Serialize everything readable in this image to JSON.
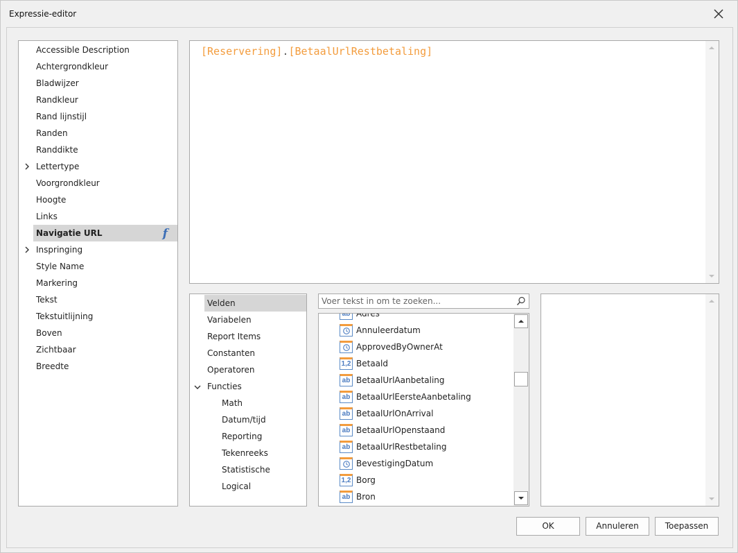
{
  "window": {
    "title": "Expressie-editor"
  },
  "properties": [
    {
      "label": "Accessible Description",
      "expandable": false,
      "selected": false
    },
    {
      "label": "Achtergrondkleur",
      "expandable": false,
      "selected": false
    },
    {
      "label": "Bladwijzer",
      "expandable": false,
      "selected": false
    },
    {
      "label": "Randkleur",
      "expandable": false,
      "selected": false
    },
    {
      "label": "Rand lijnstijl",
      "expandable": false,
      "selected": false
    },
    {
      "label": "Randen",
      "expandable": false,
      "selected": false
    },
    {
      "label": "Randdikte",
      "expandable": false,
      "selected": false
    },
    {
      "label": "Lettertype",
      "expandable": true,
      "selected": false
    },
    {
      "label": "Voorgrondkleur",
      "expandable": false,
      "selected": false
    },
    {
      "label": "Hoogte",
      "expandable": false,
      "selected": false
    },
    {
      "label": "Links",
      "expandable": false,
      "selected": false
    },
    {
      "label": "Navigatie URL",
      "expandable": false,
      "selected": true
    },
    {
      "label": "Inspringing",
      "expandable": true,
      "selected": false
    },
    {
      "label": "Style Name",
      "expandable": false,
      "selected": false
    },
    {
      "label": "Markering",
      "expandable": false,
      "selected": false
    },
    {
      "label": "Tekst",
      "expandable": false,
      "selected": false
    },
    {
      "label": "Tekstuitlijning",
      "expandable": false,
      "selected": false
    },
    {
      "label": "Boven",
      "expandable": false,
      "selected": false
    },
    {
      "label": "Zichtbaar",
      "expandable": false,
      "selected": false
    },
    {
      "label": "Breedte",
      "expandable": false,
      "selected": false
    }
  ],
  "fx_icon": "function-icon",
  "expression": {
    "part1": "[Reservering]",
    "dot": ".",
    "part2": "[BetaalUrlRestbetaling]",
    "field_color": "#f39c3d"
  },
  "categories": [
    {
      "label": "Velden",
      "level": 0,
      "selected": true
    },
    {
      "label": "Variabelen",
      "level": 0
    },
    {
      "label": "Report Items",
      "level": 0
    },
    {
      "label": "Constanten",
      "level": 0
    },
    {
      "label": "Operatoren",
      "level": 0
    },
    {
      "label": "Functies",
      "level": 0,
      "expanded": true
    },
    {
      "label": "Math",
      "level": 1
    },
    {
      "label": "Datum/tijd",
      "level": 1
    },
    {
      "label": "Reporting",
      "level": 1
    },
    {
      "label": "Tekenreeks",
      "level": 1
    },
    {
      "label": "Statistische",
      "level": 1
    },
    {
      "label": "Logical",
      "level": 1
    }
  ],
  "search": {
    "placeholder": "Voer tekst in om te zoeken..."
  },
  "fields": [
    {
      "label": "Adres",
      "type": "ab"
    },
    {
      "label": "Annuleerdatum",
      "type": "clock"
    },
    {
      "label": "ApprovedByOwnerAt",
      "type": "clock"
    },
    {
      "label": "Betaald",
      "type": "1,2"
    },
    {
      "label": "BetaalUrlAanbetaling",
      "type": "ab"
    },
    {
      "label": "BetaalUrlEersteAanbetaling",
      "type": "ab"
    },
    {
      "label": "BetaalUrlOnArrival",
      "type": "ab"
    },
    {
      "label": "BetaalUrlOpenstaand",
      "type": "ab"
    },
    {
      "label": "BetaalUrlRestbetaling",
      "type": "ab"
    },
    {
      "label": "BevestigingDatum",
      "type": "clock"
    },
    {
      "label": "Borg",
      "type": "1,2"
    },
    {
      "label": "Bron",
      "type": "ab"
    }
  ],
  "buttons": {
    "ok": "OK",
    "cancel": "Annuleren",
    "apply": "Toepassen"
  }
}
